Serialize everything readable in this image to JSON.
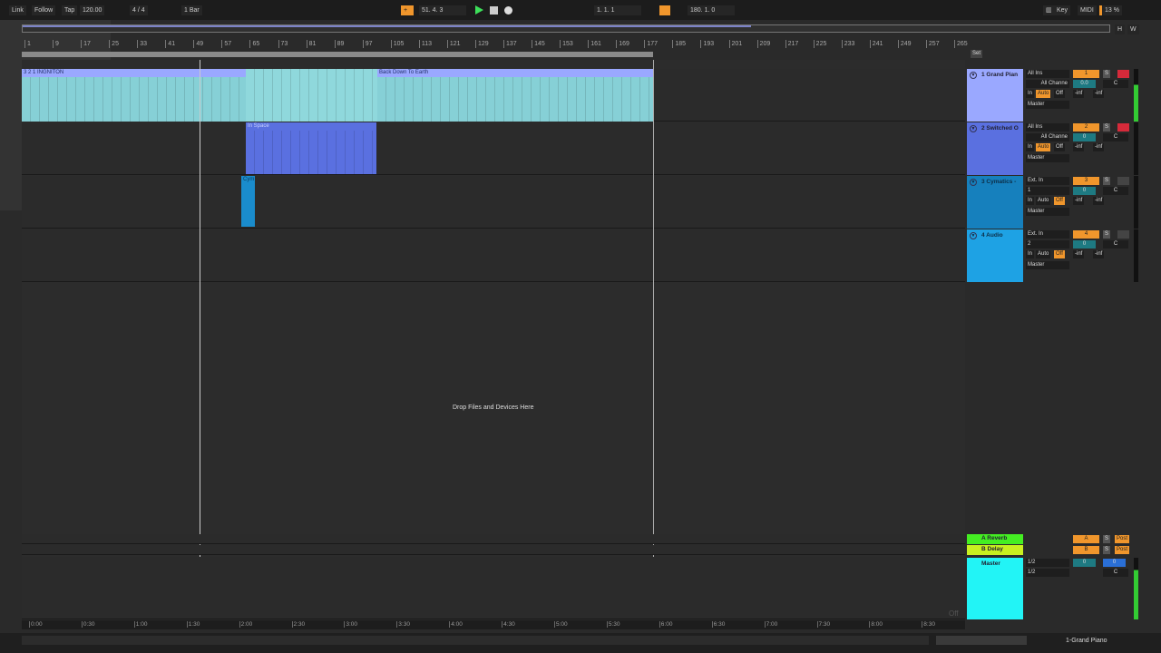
{
  "topbar": {
    "link": "Link",
    "follow": "Follow",
    "tap": "Tap",
    "tempo": "120.00",
    "time_sig": "4 / 4",
    "quantize": "1 Bar",
    "position": "51.  4.  3",
    "loop_start": "1.  1.  1",
    "loop_length": "180.  1.  0",
    "key": "Key",
    "midi": "MIDI",
    "cpu": "13 %",
    "h": "H",
    "w": "W"
  },
  "ruler": {
    "bars": [
      "1",
      "9",
      "17",
      "25",
      "33",
      "41",
      "49",
      "57",
      "65",
      "73",
      "81",
      "89",
      "97",
      "105",
      "113",
      "121",
      "129",
      "137",
      "145",
      "153",
      "161",
      "169",
      "177",
      "185",
      "193",
      "201",
      "209",
      "217",
      "225",
      "233",
      "241",
      "249",
      "257",
      "265"
    ],
    "set": "Set"
  },
  "time_ruler": [
    "0:00",
    "0:30",
    "1:00",
    "1:30",
    "2:00",
    "2:30",
    "3:00",
    "3:30",
    "4:00",
    "4:30",
    "5:00",
    "5:30",
    "6:00",
    "6:30",
    "7:00",
    "7:30",
    "8:00",
    "8:30"
  ],
  "clips": {
    "c1": "3 2 1 INGNITON",
    "c2": "Back Down To Earth",
    "c3": "In Space",
    "c4": "Cym"
  },
  "tracks": [
    {
      "name": "1 Grand Pian",
      "color": "#9aa8ff",
      "input": "All Ins",
      "channel": "All Channe",
      "out": "Master",
      "num": "1",
      "vol": "0.0",
      "pan": "C",
      "arm": true
    },
    {
      "name": "2 Switched O",
      "color": "#5a70e0",
      "input": "All Ins",
      "channel": "All Channe",
      "out": "Master",
      "num": "2",
      "vol": "0",
      "pan": "C",
      "arm": true
    },
    {
      "name": "3 Cymatics -",
      "color": "#1680bd",
      "input": "Ext. In",
      "channel": "1",
      "out": "Master",
      "num": "3",
      "vol": "0",
      "pan": "C",
      "arm": false
    },
    {
      "name": "4 Audio",
      "color": "#1ea2e4",
      "input": "Ext. In",
      "channel": "2",
      "out": "Master",
      "num": "4",
      "vol": "0",
      "pan": "C",
      "arm": false
    }
  ],
  "monitor": {
    "in": "In",
    "auto": "Auto",
    "off": "Off",
    "inf": "-inf",
    "solo": "S"
  },
  "returns": [
    {
      "name": "A Reverb",
      "color": "#44ee22",
      "letter": "A",
      "post": "Post"
    },
    {
      "name": "B Delay",
      "color": "#c8f020",
      "letter": "B",
      "post": "Post"
    }
  ],
  "master": {
    "name": "Master",
    "color": "#22f4f6",
    "out1": "1/2",
    "out2": "1/2",
    "vol": "0",
    "cue": "0",
    "pan": "C"
  },
  "drop_text": "Drop Files and Devices Here",
  "off_label": "Off",
  "bottom": {
    "selected_track": "1-Grand Piano"
  }
}
